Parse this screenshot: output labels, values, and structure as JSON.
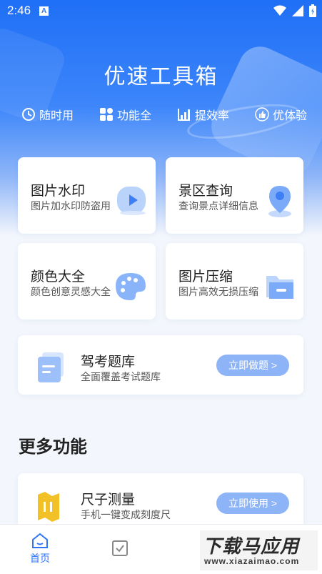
{
  "status_bar": {
    "time": "2:46",
    "badge": "A"
  },
  "app": {
    "title": "优速工具箱"
  },
  "features": [
    {
      "icon": "clock-icon",
      "label": "随时用"
    },
    {
      "icon": "grid-icon",
      "label": "功能全"
    },
    {
      "icon": "bar-chart-icon",
      "label": "提效率"
    },
    {
      "icon": "thumbs-up-icon",
      "label": "优体验"
    }
  ],
  "tools": [
    {
      "title": "图片水印",
      "subtitle": "图片加水印防盗用",
      "icon": "play-icon"
    },
    {
      "title": "景区查询",
      "subtitle": "查询景点详细信息",
      "icon": "location-pin-icon"
    },
    {
      "title": "颜色大全",
      "subtitle": "颜色创意灵感大全",
      "icon": "palette-icon"
    },
    {
      "title": "图片压缩",
      "subtitle": "图片高效无损压缩",
      "icon": "folder-icon"
    }
  ],
  "exam": {
    "title": "驾考题库",
    "subtitle": "全面覆盖考试题库",
    "button": "立即做题 >"
  },
  "more": {
    "section_title": "更多功能",
    "ruler": {
      "title": "尺子测量",
      "subtitle": "手机一键变成刻度尺",
      "button": "立即使用 >"
    }
  },
  "nav": {
    "home_label": "首页"
  },
  "watermark": {
    "big": "下载马应用",
    "small": "www.xiazaimao.com"
  },
  "colors": {
    "primary": "#2f75f6",
    "button": "#8db4f7"
  }
}
